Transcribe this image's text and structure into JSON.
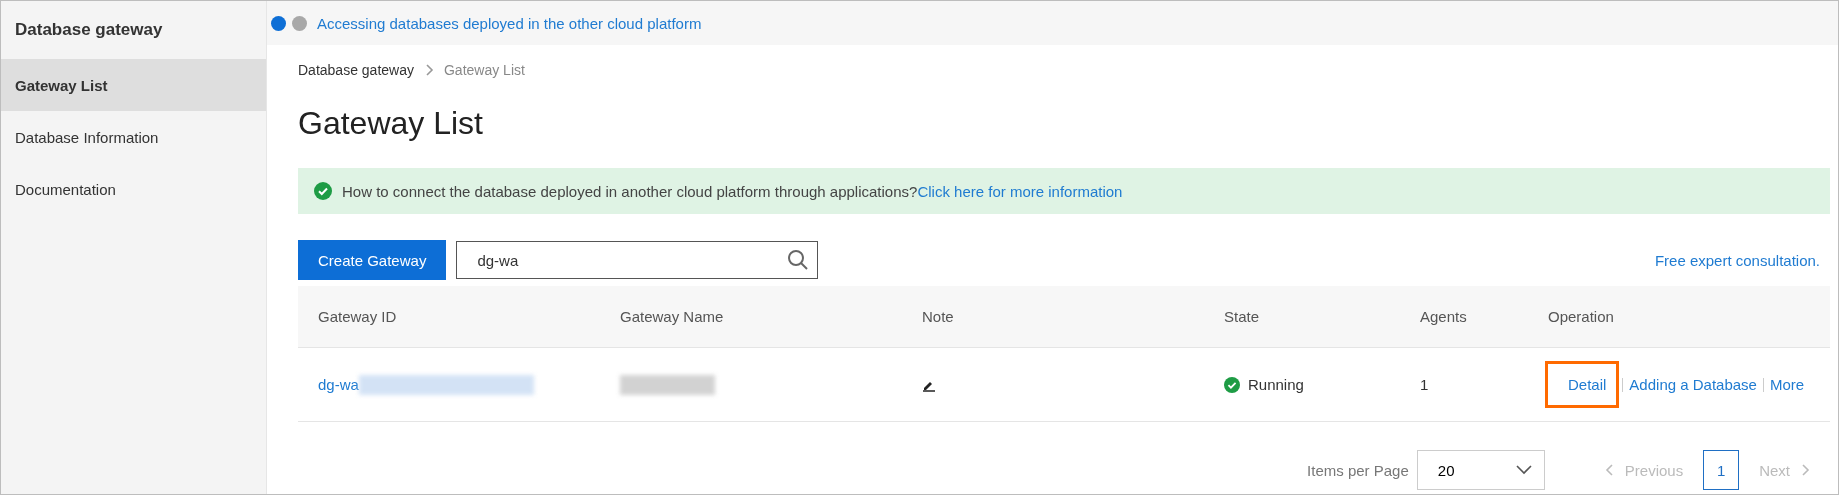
{
  "sidebar": {
    "title": "Database gateway",
    "items": [
      {
        "label": "Gateway List",
        "selected": true
      },
      {
        "label": "Database Information",
        "selected": false
      },
      {
        "label": "Documentation",
        "selected": false
      }
    ]
  },
  "top_bar": {
    "steps": [
      {
        "selected": true
      },
      {
        "selected": false
      }
    ],
    "link": "Accessing databases deployed in the other cloud platform"
  },
  "breadcrumb": [
    "Database gateway",
    "Gateway List"
  ],
  "page_title": "Gateway List",
  "alert": {
    "text": "How to connect the database deployed in another cloud platform through applications?",
    "link": "Click here for more information"
  },
  "toolbar": {
    "create_button": "Create Gateway",
    "search_value": "dg-wa",
    "consultation_link": "Free expert consultation."
  },
  "table": {
    "columns": [
      "Gateway ID",
      "Gateway Name",
      "Note",
      "State",
      "Agents",
      "Operation"
    ],
    "rows": [
      {
        "gateway_id": "dg-wa",
        "state": "Running",
        "agents": "1",
        "operations": [
          {
            "label": "Detail",
            "highlighted": true
          },
          {
            "label": "Adding a Database",
            "highlighted": false
          },
          {
            "label": "More",
            "highlighted": false
          }
        ]
      }
    ]
  },
  "pagination": {
    "items_per_page_label": "Items per Page",
    "page_size": "20",
    "previous": "Previous",
    "pages": [
      {
        "label": "1",
        "selected": true
      }
    ],
    "next": "Next"
  }
}
